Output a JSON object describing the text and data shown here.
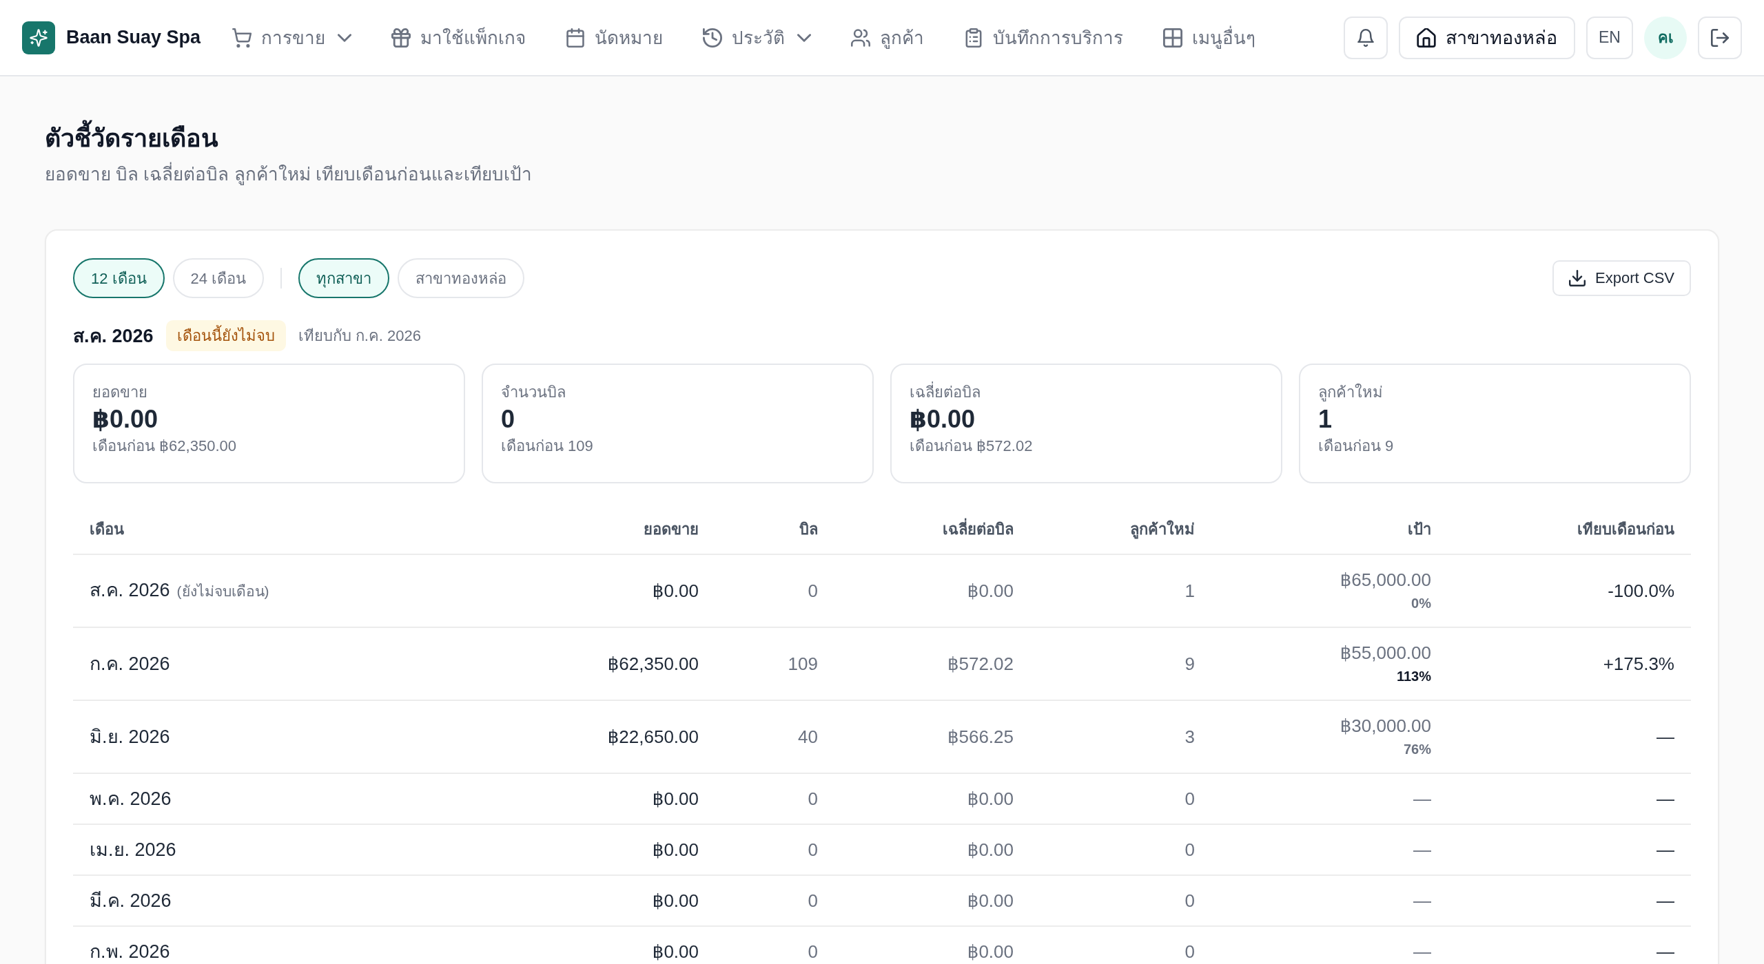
{
  "header": {
    "brand": "Baan Suay Spa",
    "nav": [
      {
        "label": "การขาย",
        "dropdown": true
      },
      {
        "label": "มาใช้แพ็กเกจ",
        "dropdown": false
      },
      {
        "label": "นัดหมาย",
        "dropdown": false
      },
      {
        "label": "ประวัติ",
        "dropdown": true
      },
      {
        "label": "ลูกค้า",
        "dropdown": false
      },
      {
        "label": "บันทึกการบริการ",
        "dropdown": false
      },
      {
        "label": "เมนูอื่นๆ",
        "dropdown": false
      }
    ],
    "branch": "สาขาทองหล่อ",
    "language": "EN",
    "avatar_initials": "คเ"
  },
  "page": {
    "title": "ตัวชี้วัดรายเดือน",
    "subtitle": "ยอดขาย บิล เฉลี่ยต่อบิล ลูกค้าใหม่ เทียบเดือนก่อนและเทียบเป้า"
  },
  "filters": {
    "periods": [
      {
        "label": "12 เดือน",
        "selected": true
      },
      {
        "label": "24 เดือน",
        "selected": false
      }
    ],
    "branches": [
      {
        "label": "ทุกสาขา",
        "selected": true
      },
      {
        "label": "สาขาทองหล่อ",
        "selected": false
      }
    ],
    "export": "Export CSV"
  },
  "period": {
    "month": "ส.ค. 2026",
    "badge": "เดือนนี้ยังไม่จบ",
    "compare": "เทียบกับ ก.ค. 2026"
  },
  "kpis": [
    {
      "label": "ยอดขาย",
      "value": "฿0.00",
      "previous": "เดือนก่อน ฿62,350.00"
    },
    {
      "label": "จำนวนบิล",
      "value": "0",
      "previous": "เดือนก่อน 109"
    },
    {
      "label": "เฉลี่ยต่อบิล",
      "value": "฿0.00",
      "previous": "เดือนก่อน ฿572.02"
    },
    {
      "label": "ลูกค้าใหม่",
      "value": "1",
      "previous": "เดือนก่อน 9"
    }
  ],
  "table": {
    "columns": [
      "เดือน",
      "ยอดขาย",
      "บิล",
      "เฉลี่ยต่อบิล",
      "ลูกค้าใหม่",
      "เป้า",
      "เทียบเดือนก่อน"
    ],
    "rows": [
      {
        "month": "ส.ค. 2026",
        "note": "(ยังไม่จบเดือน)",
        "sales": "฿0.00",
        "bills": "0",
        "avg": "฿0.00",
        "new_customers": "1",
        "target": "฿65,000.00",
        "target_pct": "0%",
        "target_met": false,
        "compare": "-100.0%"
      },
      {
        "month": "ก.ค. 2026",
        "sales": "฿62,350.00",
        "bills": "109",
        "avg": "฿572.02",
        "new_customers": "9",
        "target": "฿55,000.00",
        "target_pct": "113%",
        "target_met": true,
        "compare": "+175.3%"
      },
      {
        "month": "มิ.ย. 2026",
        "sales": "฿22,650.00",
        "bills": "40",
        "avg": "฿566.25",
        "new_customers": "3",
        "target": "฿30,000.00",
        "target_pct": "76%",
        "target_met": false,
        "compare": "—"
      },
      {
        "month": "พ.ค. 2026",
        "sales": "฿0.00",
        "bills": "0",
        "avg": "฿0.00",
        "new_customers": "0",
        "target": "—",
        "compare": "—"
      },
      {
        "month": "เม.ย. 2026",
        "sales": "฿0.00",
        "bills": "0",
        "avg": "฿0.00",
        "new_customers": "0",
        "target": "—",
        "compare": "—"
      },
      {
        "month": "มี.ค. 2026",
        "sales": "฿0.00",
        "bills": "0",
        "avg": "฿0.00",
        "new_customers": "0",
        "target": "—",
        "compare": "—"
      },
      {
        "month": "ก.พ. 2026",
        "sales": "฿0.00",
        "bills": "0",
        "avg": "฿0.00",
        "new_customers": "0",
        "target": "—",
        "compare": "—"
      }
    ]
  }
}
